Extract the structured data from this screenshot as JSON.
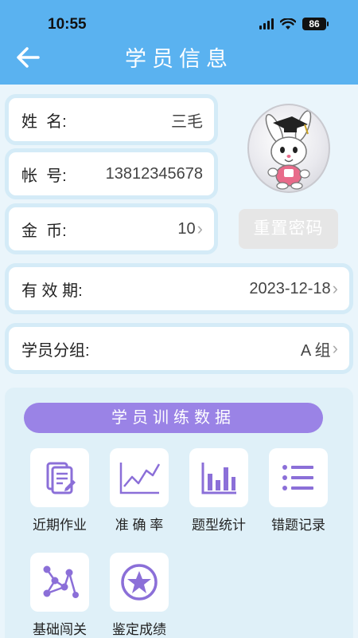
{
  "status": {
    "time": "10:55",
    "battery": "86"
  },
  "header": {
    "title": "学员信息"
  },
  "profile": {
    "name_label": "姓  名:",
    "name_value": "三毛",
    "account_label": "帐  号:",
    "account_value": "13812345678",
    "coins_label": "金  币:",
    "coins_value": "10",
    "reset_button": "重置密码"
  },
  "validity": {
    "label": "有 效 期:",
    "value": "2023-12-18"
  },
  "group": {
    "label": "学员分组:",
    "value": "A 组"
  },
  "training": {
    "title": "学员训练数据",
    "items": [
      {
        "label": "近期作业",
        "icon": "document-edit-icon"
      },
      {
        "label": "准 确 率",
        "icon": "line-chart-icon"
      },
      {
        "label": "题型统计",
        "icon": "bar-chart-icon"
      },
      {
        "label": "错题记录",
        "icon": "list-icon"
      },
      {
        "label": "基础闯关",
        "icon": "nodes-graph-icon"
      },
      {
        "label": "鉴定成绩",
        "icon": "star-icon"
      }
    ]
  },
  "colors": {
    "header": "#5ab2f0",
    "accent_purple": "#9a83e6",
    "icon_purple": "#8b6fd8",
    "background": "#eaf5fb"
  }
}
